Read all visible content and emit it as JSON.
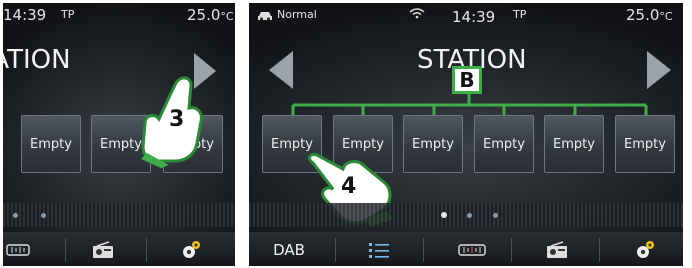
{
  "left_screen": {
    "status": {
      "time": "14:39",
      "tp": "TP",
      "temp": "25.0",
      "unit": "°C"
    },
    "title": "STATION",
    "presets": [
      "Empty",
      "Empty",
      "Empty"
    ],
    "callout": "3",
    "icons": [
      "equalizer-icon",
      "radio-icon",
      "settings-icon"
    ]
  },
  "right_screen": {
    "status": {
      "mode": "Normal",
      "time": "14:39",
      "tp": "TP",
      "temp": "25.0",
      "unit": "°C"
    },
    "title": "STATION",
    "group_label": "B",
    "presets": [
      "Empty",
      "Empty",
      "Empty",
      "Empty",
      "Empty",
      "Empty"
    ],
    "callout": "4",
    "bottom": {
      "band": "DAB"
    },
    "icons": [
      "list-icon",
      "equalizer-icon",
      "radio-icon",
      "settings-icon"
    ]
  },
  "colors": {
    "accent_green": "#3fae49",
    "background": "#22262b"
  }
}
